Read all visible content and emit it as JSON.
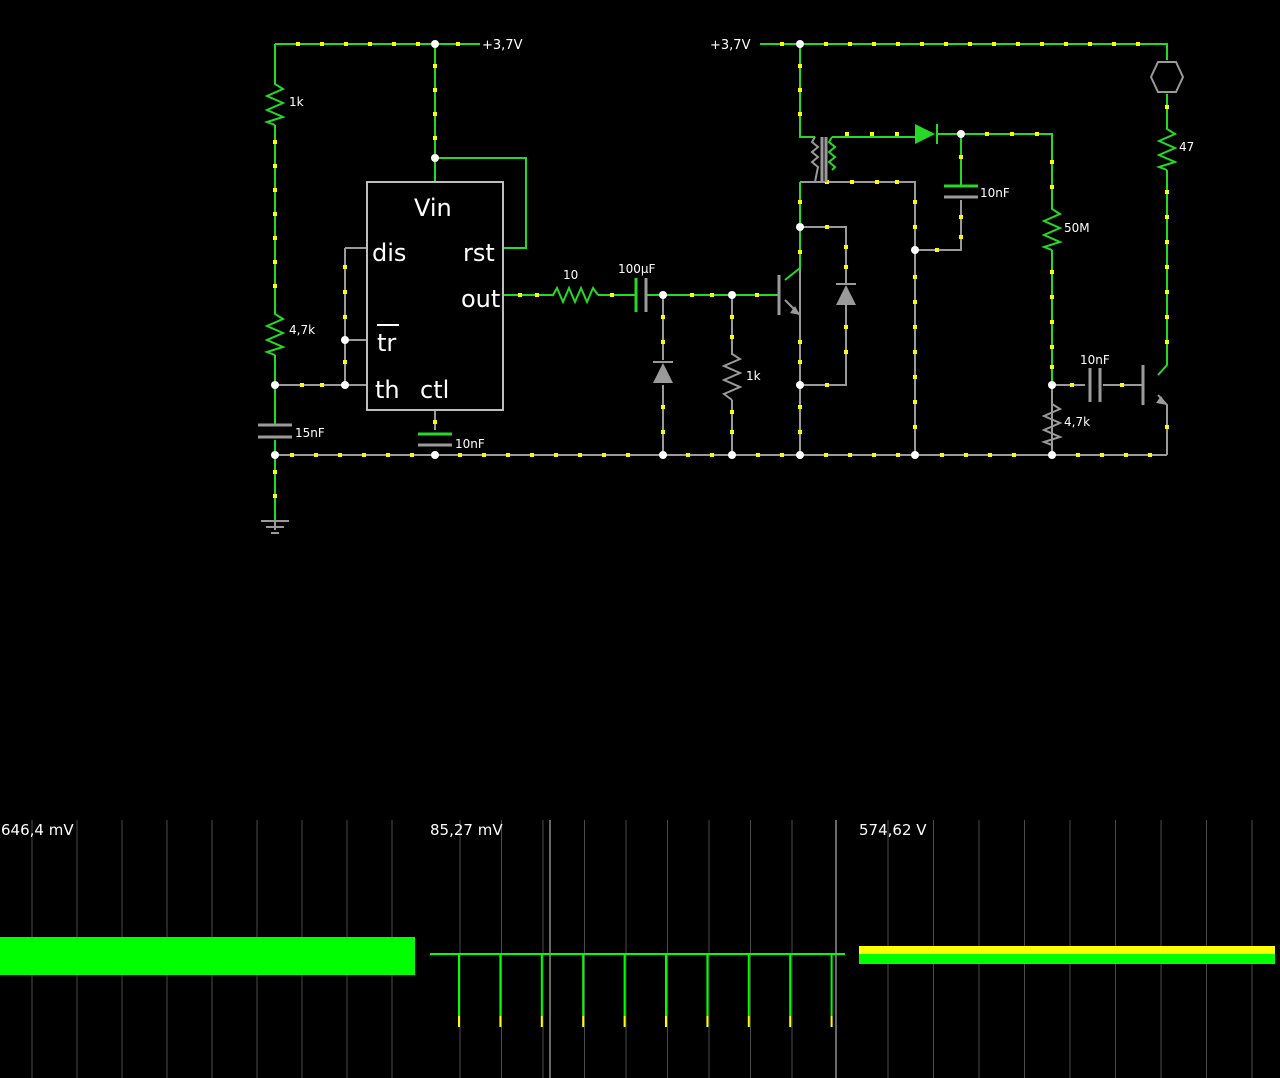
{
  "circuit": {
    "supply_left": "+3,7V",
    "supply_right": "+3,7V",
    "r_top": "1k",
    "r_mid": "4,7k",
    "c_timing": "15nF",
    "c_ctl": "10nF",
    "timer": {
      "vin": "Vin",
      "dis": "dis",
      "rst": "rst",
      "out": "out",
      "tr": "tr",
      "th": "th",
      "ctl": "ctl"
    },
    "r_out": "10",
    "c_coupling": "100µF",
    "r_base": "1k",
    "c_hv": "10nF",
    "r_hv": "50M",
    "r_lamp": "47",
    "c_trig": "10nF",
    "r_trig": "4,7k"
  },
  "colors": {
    "live": "#26d926",
    "wire": "#9a9a9a",
    "dot": "#ffff00",
    "trace": "#00ff00"
  },
  "scopes": [
    {
      "value": "646,4 mV"
    },
    {
      "value": "85,27 mV"
    },
    {
      "value": "574,62 V"
    }
  ]
}
